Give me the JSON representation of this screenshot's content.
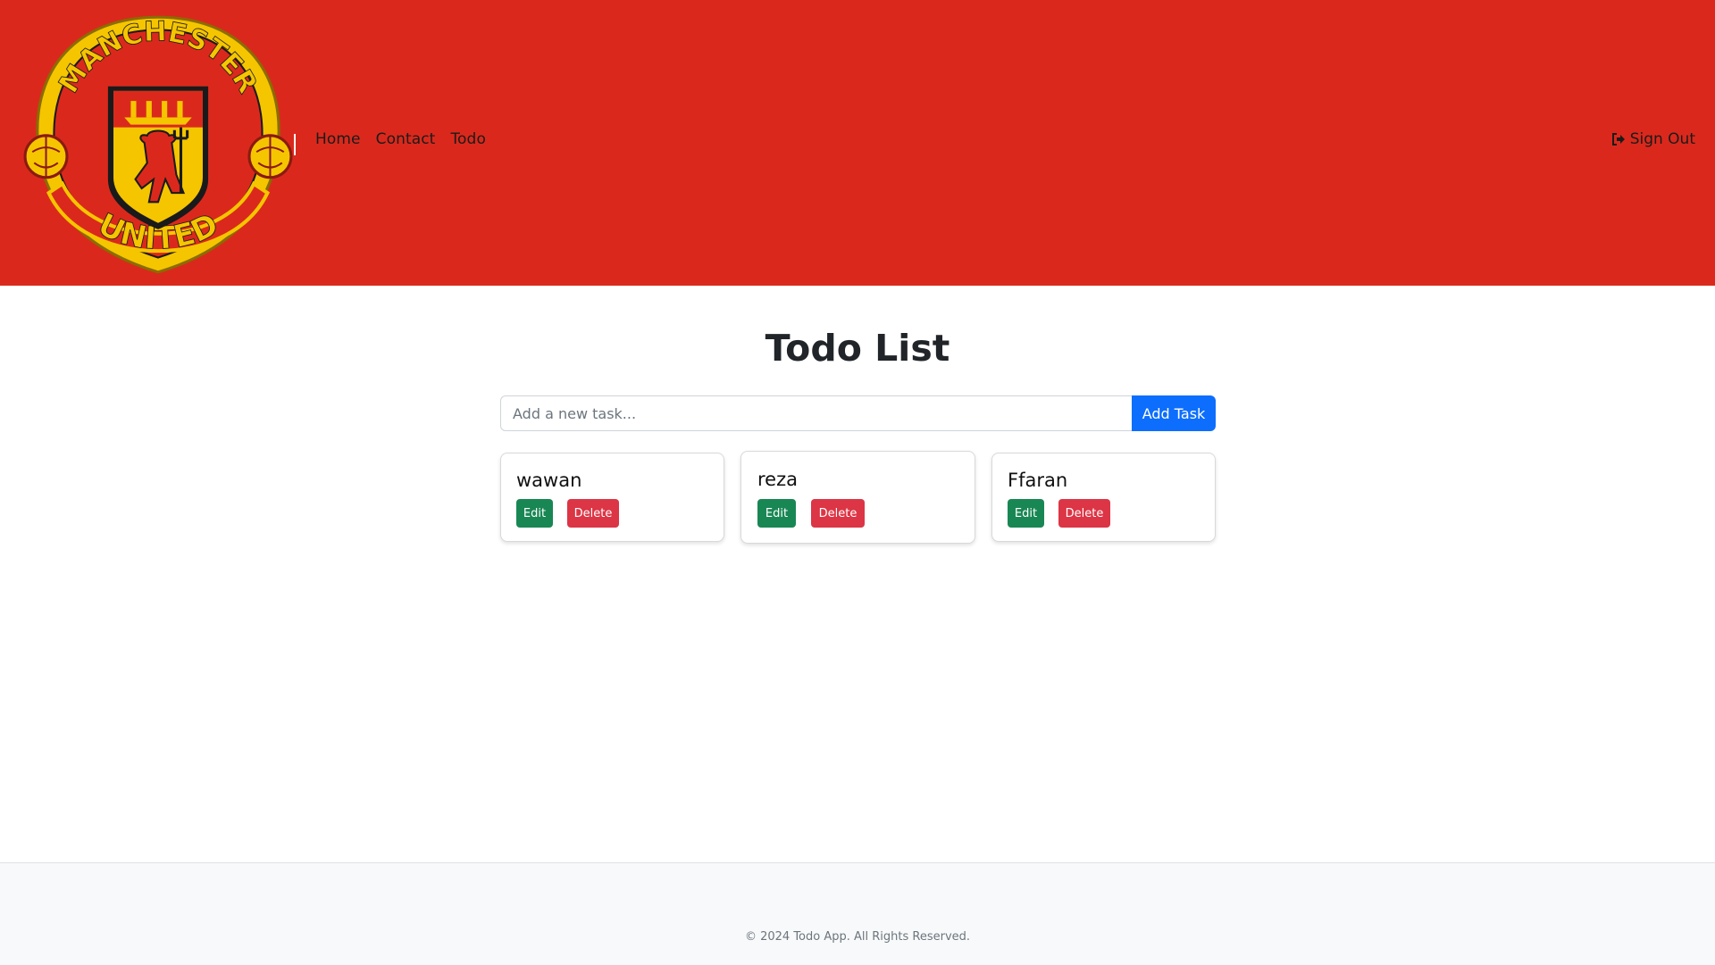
{
  "navbar": {
    "logo": "manchester-united-crest",
    "logo_text_top": "MANCHESTER",
    "logo_text_bottom": "UNITED",
    "links": [
      "Home",
      "Contact",
      "Todo"
    ],
    "signout_label": "Sign Out",
    "background": "#da291c"
  },
  "main": {
    "title": "Todo List",
    "input_placeholder": "Add a new task...",
    "input_value": "",
    "add_button": "Add Task",
    "tasks": [
      {
        "name": "wawan",
        "edit": "Edit",
        "delete": "Delete"
      },
      {
        "name": "reza",
        "edit": "Edit",
        "delete": "Delete"
      },
      {
        "name": "Ffaran",
        "edit": "Edit",
        "delete": "Delete"
      }
    ]
  },
  "footer": {
    "text": "© 2024 Todo App. All Rights Reserved."
  },
  "colors": {
    "primary": "#0d6efd",
    "success": "#198754",
    "danger": "#dc3545",
    "header": "#da291c"
  }
}
